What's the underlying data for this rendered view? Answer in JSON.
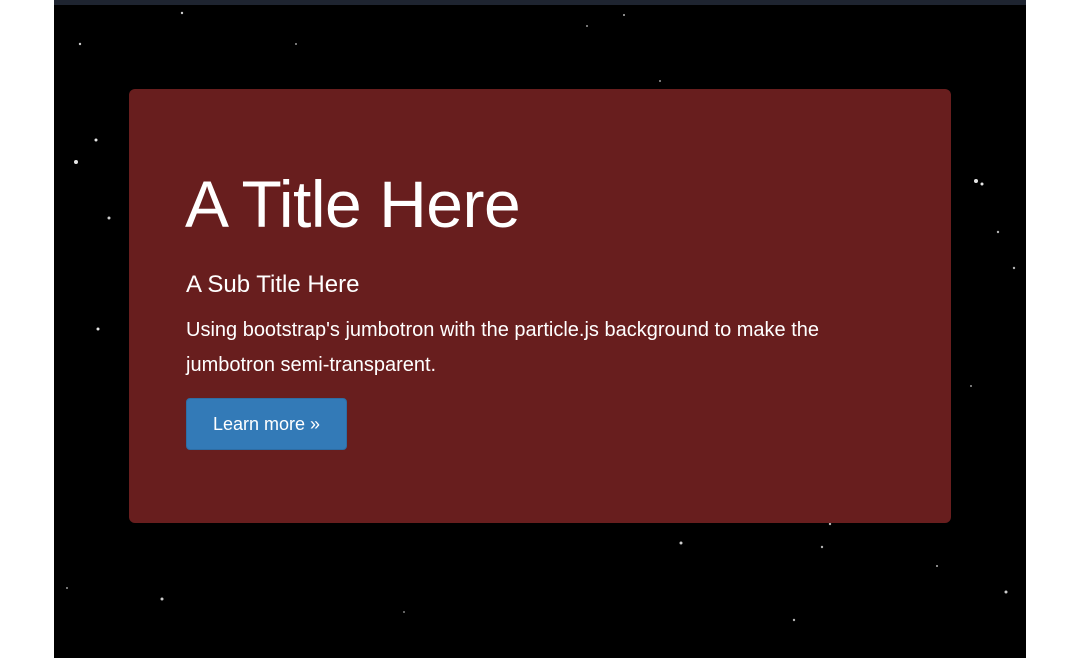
{
  "jumbotron": {
    "title": "A Title Here",
    "subtitle": "A Sub Title Here",
    "description": "Using bootstrap's jumbotron with the particle.js background to make the jumbotron semi-transparent.",
    "button_label": "Learn more »"
  },
  "colors": {
    "page_background": "#000000",
    "jumbotron_background": "#681e1e",
    "button_background": "#337ab7",
    "text": "#ffffff",
    "particle": "#ffffff"
  }
}
